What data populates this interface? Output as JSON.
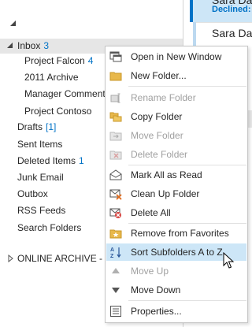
{
  "folder_pane": {
    "inbox": {
      "label": "Inbox",
      "count": "3"
    },
    "subfolders": [
      {
        "label": "Project Falcon",
        "count": "4"
      },
      {
        "label": "2011 Archive",
        "count": ""
      },
      {
        "label": "Manager Comments",
        "count": ""
      },
      {
        "label": "Project Contoso",
        "count": ""
      }
    ],
    "folders": [
      {
        "label": "Drafts",
        "count": "[1]"
      },
      {
        "label": "Sent Items",
        "count": ""
      },
      {
        "label": "Deleted Items",
        "count": "1"
      },
      {
        "label": "Junk Email",
        "count": ""
      },
      {
        "label": "Outbox",
        "count": ""
      },
      {
        "label": "RSS Feeds",
        "count": ""
      },
      {
        "label": "Search Folders",
        "count": ""
      }
    ],
    "archive": {
      "label": "ONLINE ARCHIVE - K"
    }
  },
  "mail_list": {
    "item1_name": "Sara Da",
    "item1_status": "Declined:",
    "item2_name": "Sara Da"
  },
  "context_menu": {
    "items": [
      {
        "label": "Open in New Window",
        "icon": "open-window-icon"
      },
      {
        "label": "New Folder...",
        "icon": "new-folder-icon"
      },
      {
        "label": "Rename Folder",
        "icon": "rename-folder-icon"
      },
      {
        "label": "Copy Folder",
        "icon": "copy-folder-icon"
      },
      {
        "label": "Move Folder",
        "icon": "move-folder-icon"
      },
      {
        "label": "Delete Folder",
        "icon": "delete-folder-icon"
      },
      {
        "label": "Mark All as Read",
        "icon": "mark-read-icon"
      },
      {
        "label": "Clean Up Folder",
        "icon": "clean-up-icon"
      },
      {
        "label": "Delete All",
        "icon": "delete-all-icon"
      },
      {
        "label": "Remove from Favorites",
        "icon": "favorites-icon"
      },
      {
        "label": "Sort Subfolders A to Z",
        "icon": "sort-az-icon"
      },
      {
        "label": "Move Up",
        "icon": "move-up-icon"
      },
      {
        "label": "Move Down",
        "icon": "move-down-icon"
      },
      {
        "label": "Properties...",
        "icon": "properties-icon"
      }
    ]
  },
  "colors": {
    "accent": "#0072c6",
    "hover": "#cde6f7",
    "disabled": "#a0a0a0"
  }
}
